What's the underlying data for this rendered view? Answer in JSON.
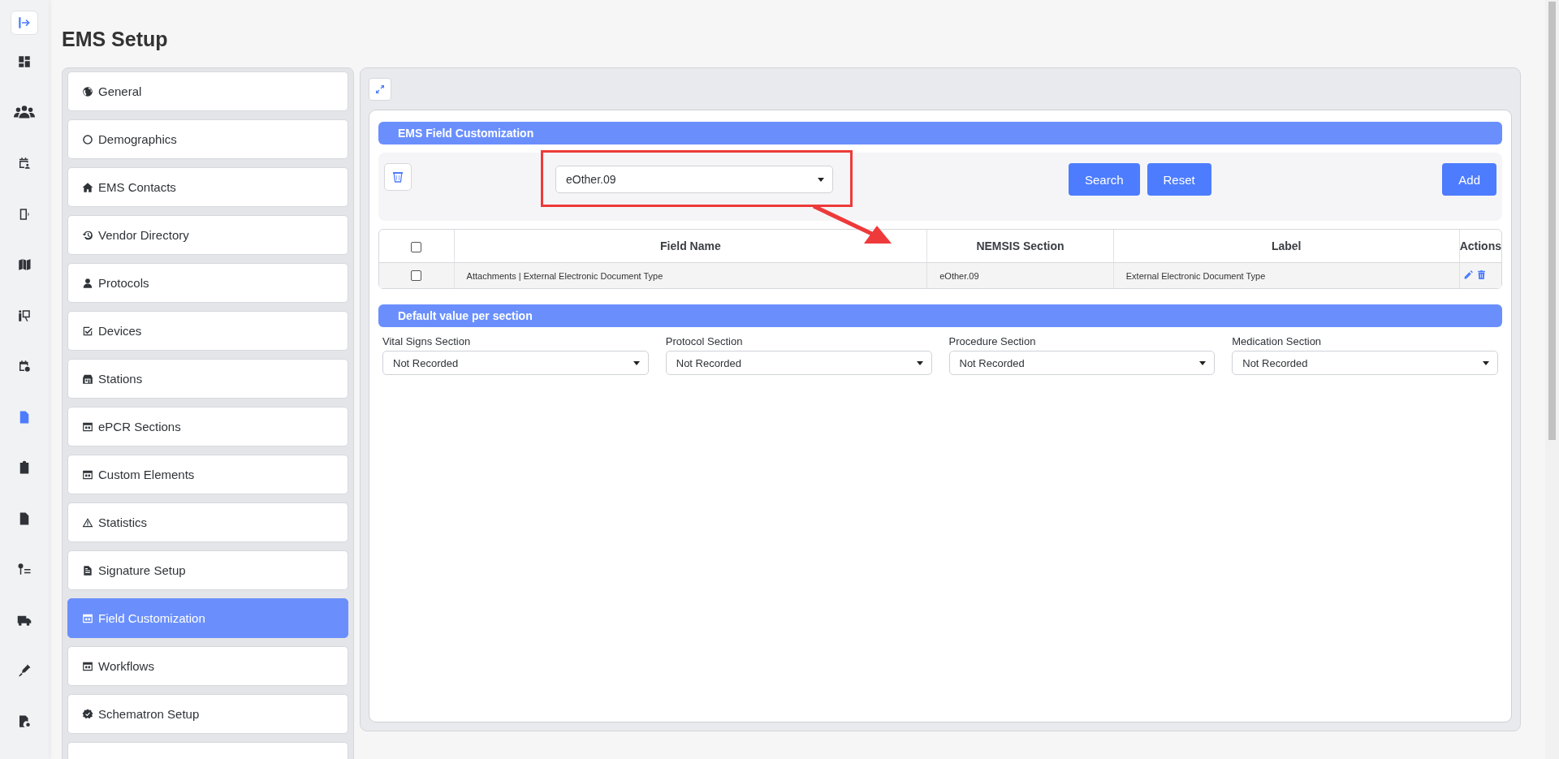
{
  "app_rail": {
    "items": [
      {
        "selected": false
      },
      {
        "selected": false
      },
      {
        "selected": false
      },
      {
        "selected": false
      },
      {
        "selected": false
      },
      {
        "selected": false
      },
      {
        "selected": false
      },
      {
        "selected": true
      },
      {
        "selected": false
      },
      {
        "selected": false
      },
      {
        "selected": false
      },
      {
        "selected": false
      },
      {
        "selected": false
      },
      {
        "selected": false
      }
    ]
  },
  "page_title": "EMS Setup",
  "sidebar": {
    "items": [
      {
        "label": "General",
        "selected": false
      },
      {
        "label": "Demographics",
        "selected": false
      },
      {
        "label": "EMS Contacts",
        "selected": false
      },
      {
        "label": "Vendor Directory",
        "selected": false
      },
      {
        "label": "Protocols",
        "selected": false
      },
      {
        "label": "Devices",
        "selected": false
      },
      {
        "label": "Stations",
        "selected": false
      },
      {
        "label": "ePCR Sections",
        "selected": false
      },
      {
        "label": "Custom Elements",
        "selected": false
      },
      {
        "label": "Statistics",
        "selected": false
      },
      {
        "label": "Signature Setup",
        "selected": false
      },
      {
        "label": "Field Customization",
        "selected": true
      },
      {
        "label": "Workflows",
        "selected": false
      },
      {
        "label": "Schematron Setup",
        "selected": false
      }
    ]
  },
  "panel": {
    "section_title": "EMS Field Customization",
    "filter": {
      "value": "eOther.09"
    },
    "buttons": [
      "Search",
      "Reset",
      "Add"
    ],
    "table": {
      "columns": [
        "Field Name",
        "NEMSIS Section",
        "Label",
        "Actions"
      ],
      "header_checked": false,
      "rows": [
        {
          "checked": false,
          "cells": [
            "Attachments | External Electronic Document Type",
            "eOther.09",
            "External Electronic Document Type"
          ]
        }
      ]
    },
    "defaults_title": "Default value per section",
    "defaults": [
      {
        "label": "Vital Signs Section",
        "value": "Not Recorded"
      },
      {
        "label": "Protocol Section",
        "value": "Not Recorded"
      },
      {
        "label": "Procedure Section",
        "value": "Not Recorded"
      },
      {
        "label": "Medication Section",
        "value": "Not Recorded"
      }
    ]
  }
}
